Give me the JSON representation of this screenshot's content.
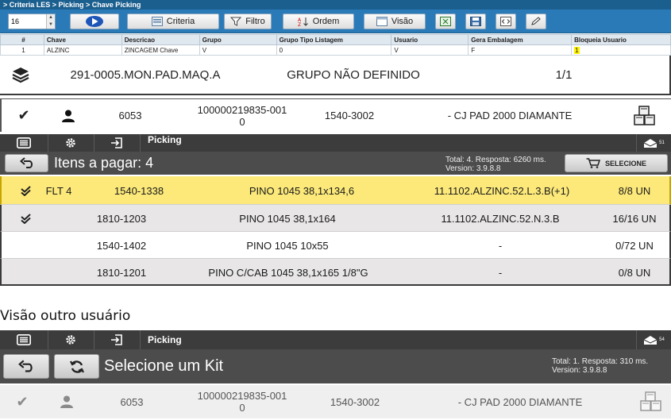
{
  "les": {
    "breadcrumb": "> Criteria LES > Picking > Chave Picking",
    "page_size": "16",
    "buttons": {
      "criteria": "Criteria",
      "filtro": "Filtro",
      "ordem": "Ordem",
      "visao": "Visão"
    },
    "columns": [
      "#",
      "Chave",
      "Descricao",
      "Grupo",
      "Grupo Tipo Listagem",
      "Usuario",
      "Gera Embalagem",
      "Bloqueia Usuario"
    ],
    "rows": [
      [
        "1",
        "ALZINC",
        "ZINCAGEM Chave",
        "V",
        "0",
        "V",
        "F",
        "1"
      ]
    ]
  },
  "machine_bar": {
    "code": "291-0005.MON.PAD.MAQ.A",
    "group": "GRUPO NÃO DEFINIDO",
    "pages": "1/1"
  },
  "kit_row": {
    "user_id": "6053",
    "order_line1": "100000219835-001",
    "order_line2": "0",
    "ref": "1540-3002",
    "description": "- CJ PAD 2000 DIAMANTE"
  },
  "app1": {
    "title": "Picking",
    "badge": "51",
    "heading": "Itens a pagar: 4",
    "info_line1": "Total: 4. Resposta: 6260 ms.",
    "info_line2": "Version: 3.9.8.8",
    "select_label": "SELECIONE",
    "items": [
      {
        "tag": "FLT 4",
        "code": "1540-1338",
        "desc": "PINO 1045 38,1x134,6",
        "loc": "11.1102.ALZINC.52.L.3.B(+1)",
        "qty": "8/8 UN"
      },
      {
        "tag": "",
        "code": "1810-1203",
        "desc": "PINO 1045 38,1x164",
        "loc": "11.1102.ALZINC.52.N.3.B",
        "qty": "16/16 UN"
      },
      {
        "tag": "",
        "code": "1540-1402",
        "desc": "PINO 1045 10x55",
        "loc": "-",
        "qty": "0/72 UN"
      },
      {
        "tag": "",
        "code": "1810-1201",
        "desc": "PINO C/CAB 1045 38,1x165 1/8\"G",
        "loc": "-",
        "qty": "0/8 UN"
      }
    ]
  },
  "section_label": "Visão outro usuário",
  "app2": {
    "title": "Picking",
    "badge": "54",
    "heading": "Selecione um Kit",
    "info_line1": "Total: 1. Resposta: 310 ms.",
    "info_line2": "Version: 3.9.8.8",
    "kit": {
      "user_id": "6053",
      "order_line1": "100000219835-001",
      "order_line2": "0",
      "ref": "1540-3002",
      "description": "- CJ PAD 2000 DIAMANTE"
    }
  },
  "colors": {
    "les_blue": "#2b7ab8",
    "dark_bar": "#3c3c3c",
    "action_bar": "#4c4c4c",
    "selected_row": "#fce97a",
    "alt_row": "#e8e6e6"
  }
}
